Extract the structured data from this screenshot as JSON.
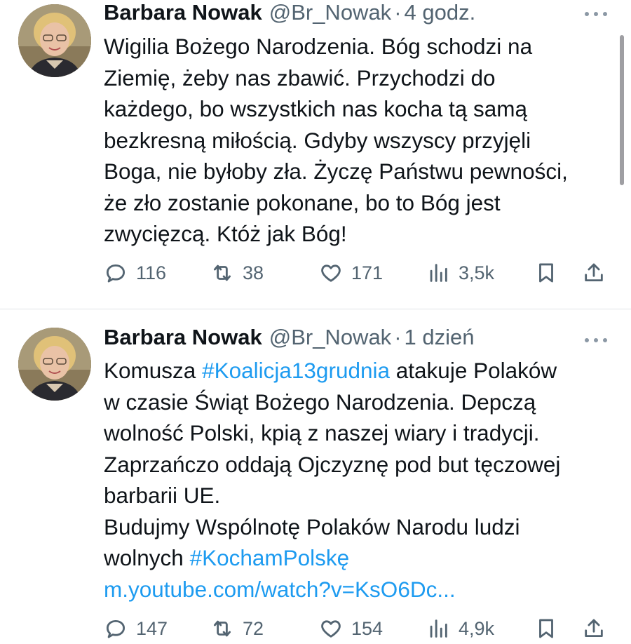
{
  "tweets": [
    {
      "author_name": "Barbara Nowak",
      "handle": "@Br_Nowak",
      "separator": "·",
      "time": "4 godz.",
      "lines": [
        [
          {
            "text": "Wigilia Bożego Narodzenia. Bóg schodzi na"
          }
        ],
        [
          {
            "text": "Ziemię,  żeby nas zbawić. Przychodzi do"
          }
        ],
        [
          {
            "text": "każdego, bo wszystkich nas kocha tą samą"
          }
        ],
        [
          {
            "text": "bezkresną miłością.  Gdyby wszyscy przyjęli"
          }
        ],
        [
          {
            "text": "Boga, nie byłoby zła. Życzę Państwu pewności,"
          }
        ],
        [
          {
            "text": "że zło zostanie pokonane, bo to Bóg jest"
          }
        ],
        [
          {
            "text": "zwycięzcą. Któż jak Bóg!"
          }
        ]
      ],
      "stats": {
        "replies": "116",
        "retweets": "38",
        "likes": "171",
        "views": "3,5k"
      }
    },
    {
      "author_name": "Barbara Nowak",
      "handle": "@Br_Nowak",
      "separator": "·",
      "time": "1 dzień",
      "lines": [
        [
          {
            "text": "Komusza "
          },
          {
            "text": "#Koalicja13grudnia",
            "link": true
          },
          {
            "text": " atakuje Polaków"
          }
        ],
        [
          {
            "text": "w czasie Świąt Bożego Narodzenia. Depczą"
          }
        ],
        [
          {
            "text": "wolność Polski, kpią z naszej wiary i tradycji."
          }
        ],
        [
          {
            "text": "Zaprzańczo oddają Ojczyznę pod but tęczowej"
          }
        ],
        [
          {
            "text": "barbarii UE."
          }
        ],
        [
          {
            "text": "Budujmy Wspólnotę Polaków Narodu ludzi"
          }
        ],
        [
          {
            "text": "wolnych "
          },
          {
            "text": "#KochamPolskę",
            "link": true
          }
        ],
        [
          {
            "text": "m.youtube.com/watch?v=KsO6Dc...",
            "link": true
          }
        ]
      ],
      "stats": {
        "replies": "147",
        "retweets": "72",
        "likes": "154",
        "views": "4,9k"
      }
    }
  ],
  "icons": {
    "avatar": "avatar-photo",
    "more": "more-dots-icon",
    "reply": "reply-icon",
    "retweet": "retweet-icon",
    "like": "heart-icon",
    "views": "views-icon",
    "bookmark": "bookmark-icon",
    "share": "share-icon"
  },
  "colors": {
    "text": "#0f1419",
    "secondary": "#536471",
    "link": "#1d9bf0",
    "divider": "#dfe3e6"
  }
}
